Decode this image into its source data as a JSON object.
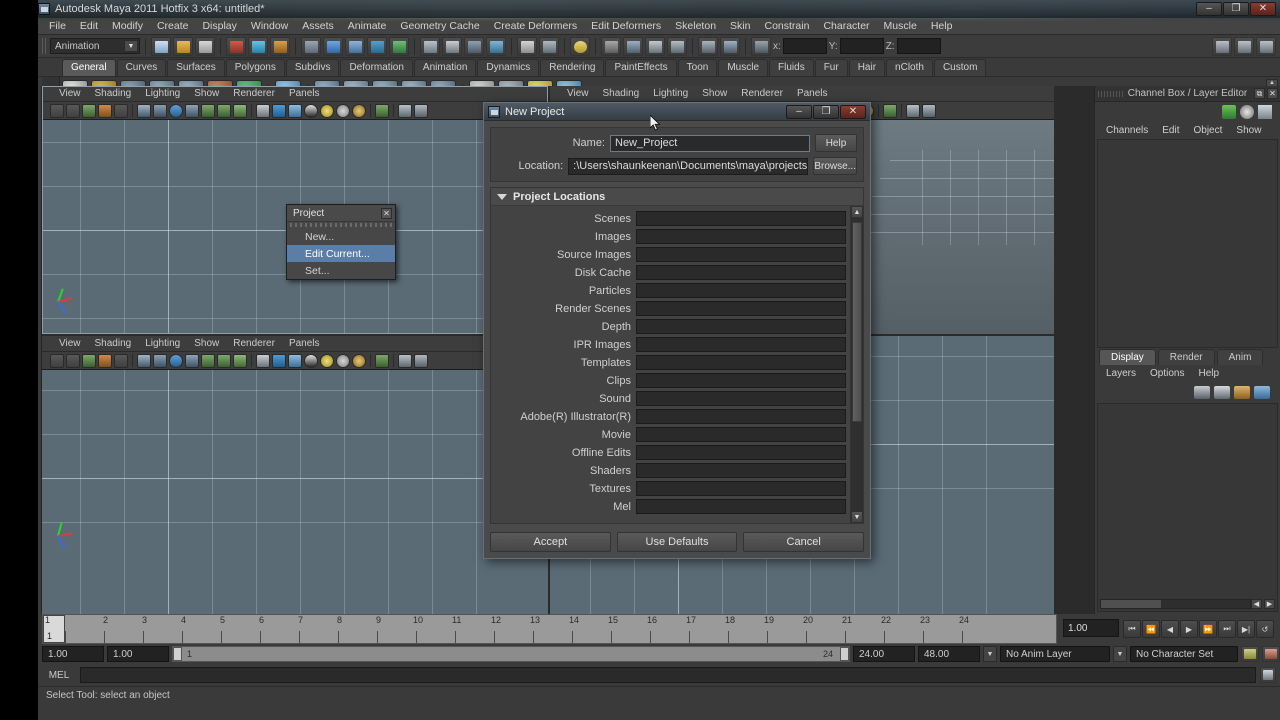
{
  "window": {
    "title": "Autodesk Maya 2011 Hotfix 3 x64: untitled*",
    "minimize": "–",
    "maximize": "❐",
    "close": "✕"
  },
  "menubar": {
    "items": [
      "File",
      "Edit",
      "Modify",
      "Create",
      "Display",
      "Window",
      "Assets",
      "Animate",
      "Geometry Cache",
      "Create Deformers",
      "Edit Deformers",
      "Skeleton",
      "Skin",
      "Constrain",
      "Character",
      "Muscle",
      "Help"
    ]
  },
  "statusbar": {
    "menu_set": "Animation",
    "x_label": "x:",
    "y_label": "Y:",
    "z_label": "Z:",
    "x_value": "",
    "y_value": "",
    "z_value": ""
  },
  "shelf": {
    "tabs": [
      "General",
      "Curves",
      "Surfaces",
      "Polygons",
      "Subdivs",
      "Deformation",
      "Animation",
      "Dynamics",
      "Rendering",
      "PaintEffects",
      "Toon",
      "Muscle",
      "Fluids",
      "Fur",
      "Hair",
      "nCloth",
      "Custom"
    ],
    "active_tab": "General",
    "scroll_up": "▲",
    "scroll_down": "▼"
  },
  "viewport": {
    "menus": [
      "View",
      "Shading",
      "Lighting",
      "Show",
      "Renderer",
      "Panels"
    ]
  },
  "channel_box": {
    "title": "Channel Box / Layer Editor",
    "dock_icon": "⧉",
    "close_icon": "✕",
    "menus": [
      "Channels",
      "Edit",
      "Object",
      "Show"
    ]
  },
  "layer_editor": {
    "tabs": [
      "Display",
      "Render",
      "Anim"
    ],
    "active_tab": "Display",
    "menus": [
      "Layers",
      "Options",
      "Help"
    ],
    "scroll_left": "◀",
    "scroll_right": "▶"
  },
  "timeline": {
    "frame_numbers": [
      "1",
      "2",
      "3",
      "4",
      "5",
      "6",
      "7",
      "8",
      "9",
      "10",
      "11",
      "12",
      "13",
      "14",
      "15",
      "16",
      "17",
      "18",
      "19",
      "20",
      "21",
      "22",
      "23",
      "24"
    ],
    "current_frame_marker": "1",
    "current_time_field": "1.00",
    "playback_buttons": [
      "⏮",
      "⏪",
      "◀",
      "▶",
      "⏩",
      "⏭",
      "▶|",
      "↺"
    ]
  },
  "range": {
    "anim_start": "1.00",
    "range_start": "1.00",
    "slider_start": "1",
    "slider_end": "24",
    "range_end": "24.00",
    "anim_end": "48.00",
    "anim_layer": "No Anim Layer",
    "character_set": "No Character Set",
    "dropdown_arrow": "▼"
  },
  "command_line": {
    "label": "MEL",
    "input_value": ""
  },
  "status_line": {
    "message": "Select Tool: select an object"
  },
  "project_menu": {
    "title": "Project",
    "close_icon": "✕",
    "items": [
      {
        "label": "New...",
        "highlighted": false
      },
      {
        "label": "Edit Current...",
        "highlighted": true
      },
      {
        "label": "Set...",
        "highlighted": false
      }
    ]
  },
  "dialog": {
    "title": "New Project",
    "minimize": "–",
    "maximize": "❐",
    "close": "✕",
    "name_label": "Name:",
    "name_value": "New_Project",
    "help_button": "Help",
    "location_label": "Location:",
    "location_value": ":\\Users\\shaunkeenan\\Documents\\maya\\projects",
    "browse_button": "Browse...",
    "group_title": "Project Locations",
    "locations": [
      {
        "label": "Scenes",
        "value": ""
      },
      {
        "label": "Images",
        "value": ""
      },
      {
        "label": "Source Images",
        "value": ""
      },
      {
        "label": "Disk Cache",
        "value": ""
      },
      {
        "label": "Particles",
        "value": ""
      },
      {
        "label": "Render Scenes",
        "value": ""
      },
      {
        "label": "Depth",
        "value": ""
      },
      {
        "label": "IPR Images",
        "value": ""
      },
      {
        "label": "Templates",
        "value": ""
      },
      {
        "label": "Clips",
        "value": ""
      },
      {
        "label": "Sound",
        "value": ""
      },
      {
        "label": "Adobe(R) Illustrator(R)",
        "value": ""
      },
      {
        "label": "Movie",
        "value": ""
      },
      {
        "label": "Offline Edits",
        "value": ""
      },
      {
        "label": "Shaders",
        "value": ""
      },
      {
        "label": "Textures",
        "value": ""
      },
      {
        "label": "Mel",
        "value": ""
      }
    ],
    "scroll_up": "▲",
    "scroll_down": "▼",
    "accept_button": "Accept",
    "use_defaults_button": "Use Defaults",
    "cancel_button": "Cancel"
  },
  "colors": {
    "accent_highlight": "#5b7ea8",
    "viewport_bg": "#5b6b76",
    "panel_bg": "#3a3a3a",
    "close_red": "#8c3b32"
  }
}
